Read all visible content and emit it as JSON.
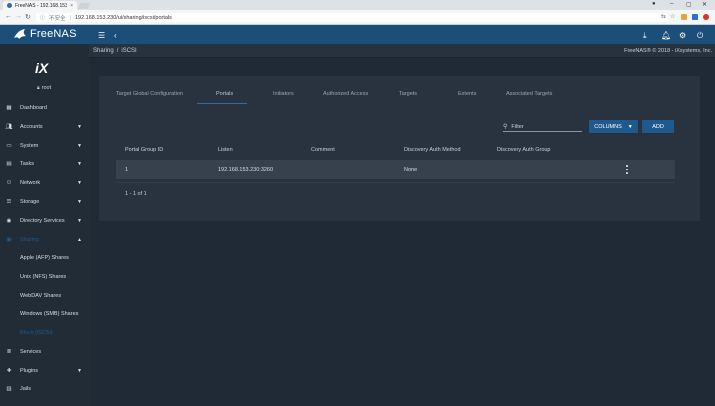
{
  "browser": {
    "tab_title": "FreeNAS - 192.168.153.2",
    "tab_close": "×",
    "secure_label": "不安全",
    "url": "192.168.153.230/ui/sharing/iscsi/portals",
    "win_min": "–",
    "win_max": "▢",
    "win_close": "✕",
    "win_user": "●"
  },
  "app": {
    "brand": "FreeNAS",
    "breadcrumb": [
      "Sharing",
      "iSCSI"
    ],
    "copyright": "FreeNAS® © 2018 - iXsystems, Inc.",
    "accent": "#1f5a8f"
  },
  "sidebar": {
    "logo_text": "iX",
    "user": "root",
    "items": [
      {
        "label": "Dashboard",
        "icon": "dashboard-icon",
        "caret": ""
      },
      {
        "label": "Accounts",
        "icon": "accounts-icon",
        "caret": "▼"
      },
      {
        "label": "System",
        "icon": "system-icon",
        "caret": "▼"
      },
      {
        "label": "Tasks",
        "icon": "tasks-icon",
        "caret": "▼"
      },
      {
        "label": "Network",
        "icon": "network-icon",
        "caret": "▼"
      },
      {
        "label": "Storage",
        "icon": "storage-icon",
        "caret": "▼"
      },
      {
        "label": "Directory Services",
        "icon": "directory-icon",
        "caret": "▼"
      },
      {
        "label": "Sharing",
        "icon": "sharing-icon",
        "caret": "▲"
      }
    ],
    "sub_items": [
      "Apple (AFP) Shares",
      "Unix (NFS) Shares",
      "WebDAV Shares",
      "Windows (SMB) Shares",
      "Block (iSCSI)"
    ],
    "bottom_items": [
      {
        "label": "Services",
        "icon": "services-icon",
        "caret": ""
      },
      {
        "label": "Plugins",
        "icon": "plugins-icon",
        "caret": "▼"
      },
      {
        "label": "Jails",
        "icon": "jails-icon",
        "caret": ""
      }
    ]
  },
  "tabs": [
    "Target Global Configuration",
    "Portals",
    "Initiators",
    "Authorized Access",
    "Targets",
    "Extents",
    "Associated Targets"
  ],
  "active_tab": "Portals",
  "toolbar": {
    "filter_placeholder": "Filter",
    "columns_label": "COLUMNS",
    "add_label": "ADD"
  },
  "table": {
    "columns": [
      "Portal Group ID",
      "Listen",
      "Comment",
      "Discovery Auth Method",
      "Discovery Auth Group"
    ],
    "rows": [
      {
        "portal_group_id": "1",
        "listen": "192.168.153.230:3260",
        "comment": "",
        "discovery_auth_method": "None",
        "discovery_auth_group": ""
      }
    ],
    "pagination": "1 - 1 of 1"
  }
}
